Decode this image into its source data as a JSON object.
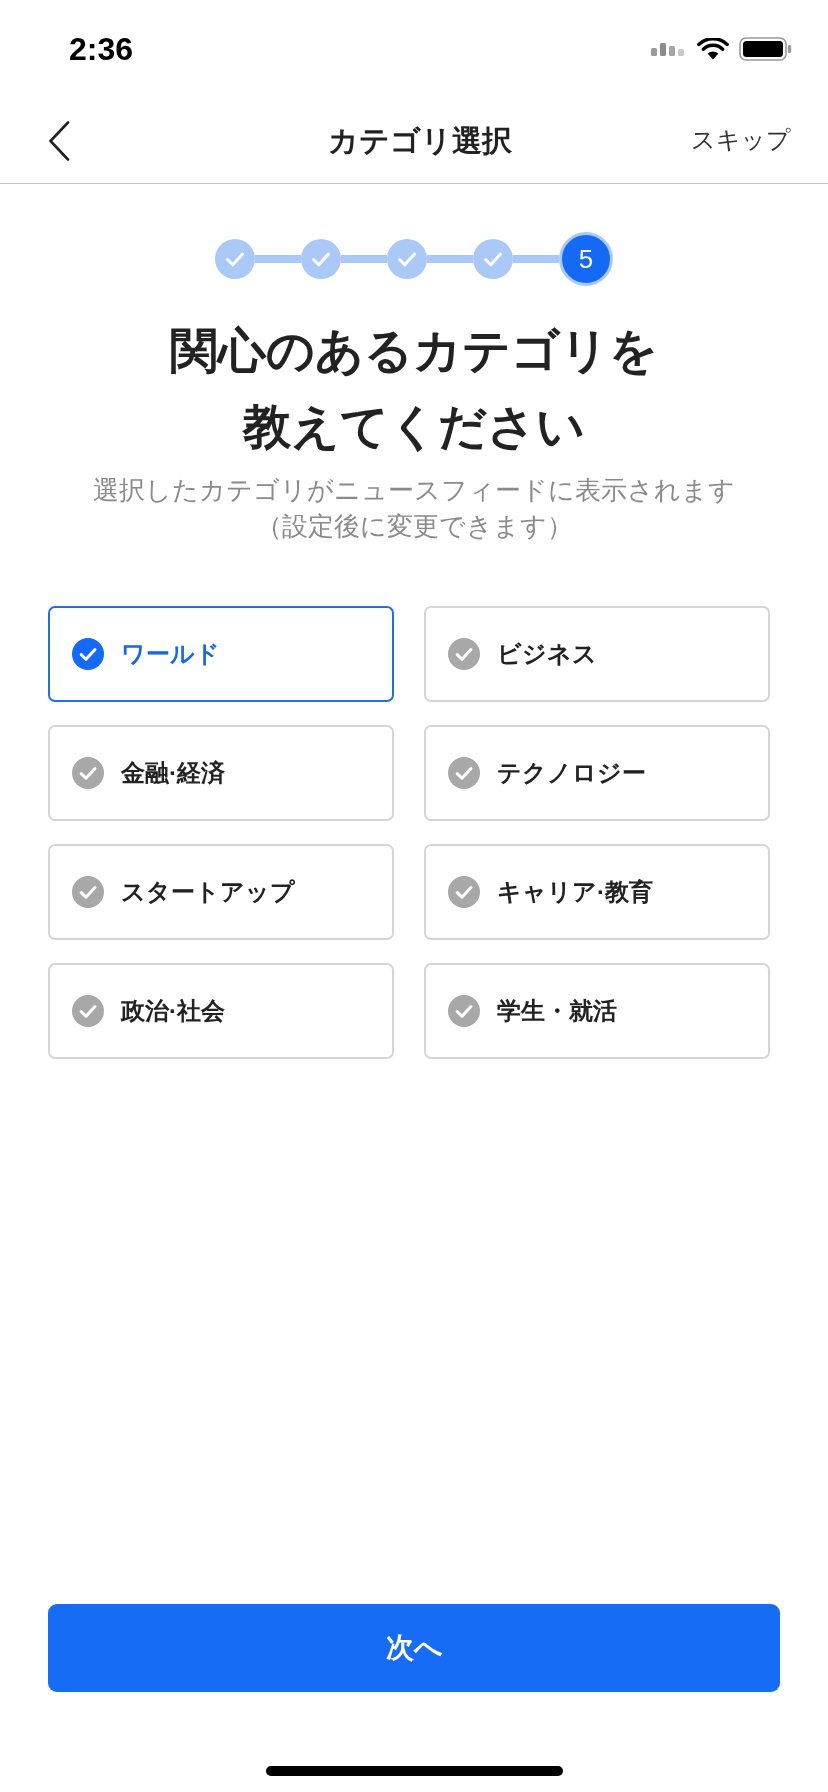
{
  "status_bar": {
    "time": "2:36"
  },
  "nav": {
    "title": "カテゴリ選択",
    "action": "スキップ"
  },
  "stepper": {
    "steps": [
      {
        "completed": true,
        "current": false
      },
      {
        "completed": true,
        "current": false
      },
      {
        "completed": true,
        "current": false
      },
      {
        "completed": true,
        "current": false
      },
      {
        "completed": false,
        "current": true,
        "label": "5"
      }
    ]
  },
  "heading": "関心のあるカテゴリを教えてください",
  "subtitle": "選択したカテゴリがニュースフィードに表示されます",
  "note": "（設定後に変更できます）",
  "categories": [
    {
      "label": "ワールド",
      "selected": true
    },
    {
      "label": "ビジネス",
      "selected": false
    },
    {
      "label": "金融·経済",
      "selected": false
    },
    {
      "label": "テクノロジー",
      "selected": false
    },
    {
      "label": "スタートアップ",
      "selected": false
    },
    {
      "label": "キャリア·教育",
      "selected": false
    },
    {
      "label": "政治·社会",
      "selected": false
    },
    {
      "label": "学生・就活",
      "selected": false
    }
  ],
  "next_button": "次へ"
}
